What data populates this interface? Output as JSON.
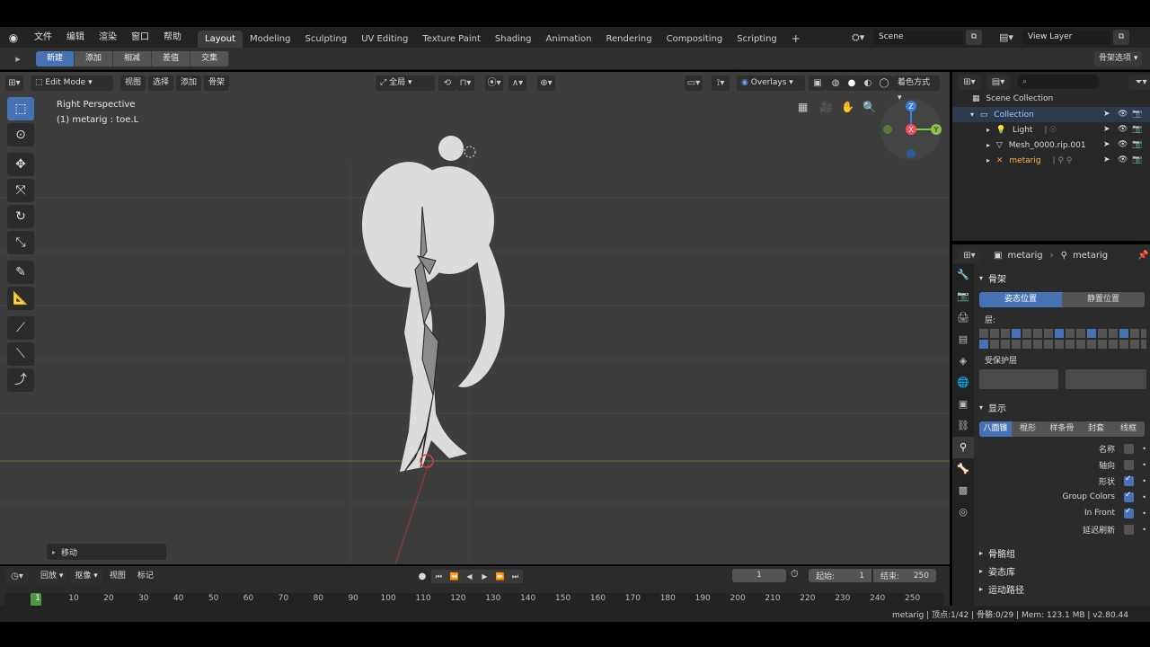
{
  "menu": [
    "文件",
    "编辑",
    "渲染",
    "窗口",
    "帮助"
  ],
  "workspaces": [
    "Layout",
    "Modeling",
    "Sculpting",
    "UV Editing",
    "Texture Paint",
    "Shading",
    "Animation",
    "Rendering",
    "Compositing",
    "Scripting"
  ],
  "active_workspace": "Layout",
  "scene": "Scene",
  "view_layer": "View Layer",
  "mode_buttons": [
    "新建",
    "添加",
    "相减",
    "差值",
    "交集"
  ],
  "armature_options": "骨架选项",
  "viewport": {
    "mode": "Edit Mode",
    "menus": [
      "视图",
      "选择",
      "添加",
      "骨架"
    ],
    "transform_orientation": "全局",
    "overlays": "Overlays",
    "shading": "着色方式",
    "view_name": "Right Perspective",
    "active_object": "(1) metarig : toe.L",
    "gizmo_axes": {
      "z": "Z",
      "y": "Y",
      "x": "X"
    },
    "last_operator": "移动"
  },
  "outliner": {
    "root": "Scene Collection",
    "collection": "Collection",
    "items": [
      "Light",
      "Mesh_0000.rip.001",
      "metarig"
    ]
  },
  "properties": {
    "breadcrumb_obj": "metarig",
    "breadcrumb_data": "metarig",
    "skeleton_panel": "骨架",
    "pose_position": "姿态位置",
    "rest_position": "静置位置",
    "layers_label": "层:",
    "protected_layers_label": "受保护层",
    "display_panel": "显示",
    "display_types": [
      "八面锥",
      "棍形",
      "样条骨",
      "封套",
      "线框"
    ],
    "display_options": [
      {
        "label": "名称",
        "checked": false
      },
      {
        "label": "轴向",
        "checked": false
      },
      {
        "label": "形状",
        "checked": true
      },
      {
        "label": "Group Colors",
        "checked": true
      },
      {
        "label": "In Front",
        "checked": true
      },
      {
        "label": "延迟刷新",
        "checked": false
      }
    ],
    "collapsed_panels": [
      "骨骼组",
      "姿态库",
      "运动路径"
    ]
  },
  "timeline": {
    "menus": [
      "回放",
      "抠像",
      "视图",
      "标记"
    ],
    "current_frame": "1",
    "start_label": "起始:",
    "start": "1",
    "end_label": "结束:",
    "end": "250",
    "ticks": [
      "1",
      "10",
      "20",
      "30",
      "40",
      "50",
      "60",
      "70",
      "80",
      "90",
      "100",
      "110",
      "120",
      "130",
      "140",
      "150",
      "160",
      "170",
      "180",
      "190",
      "200",
      "210",
      "220",
      "230",
      "240",
      "250"
    ]
  },
  "status": "metarig | 顶点:1/42 | 骨骼:0/29 | Mem: 123.1 MB | v2.80.44",
  "colors": {
    "accent": "#4772b3",
    "bg": "#3d3d3d",
    "panel": "#2b2b2b",
    "x_axis": "#f54d5b",
    "y_axis": "#8bc34a",
    "z_axis": "#3d7ee0"
  }
}
